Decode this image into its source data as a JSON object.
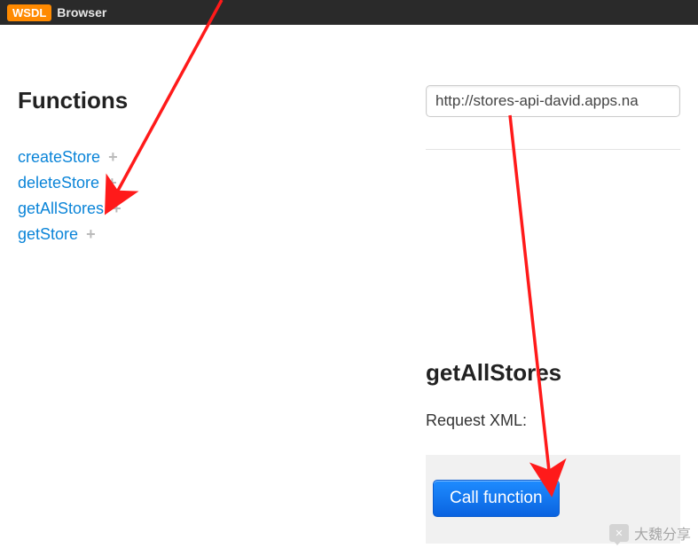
{
  "header": {
    "badge": "WSDL",
    "title": "Browser"
  },
  "sidebar": {
    "heading": "Functions",
    "items": [
      {
        "label": "createStore"
      },
      {
        "label": "deleteStore"
      },
      {
        "label": "getAllStores"
      },
      {
        "label": "getStore"
      }
    ]
  },
  "main": {
    "url_value": "http://stores-api-david.apps.na",
    "selected_function": "getAllStores",
    "request_label": "Request XML:",
    "call_button_label": "Call function"
  },
  "watermark": {
    "text": "大魏分享"
  }
}
